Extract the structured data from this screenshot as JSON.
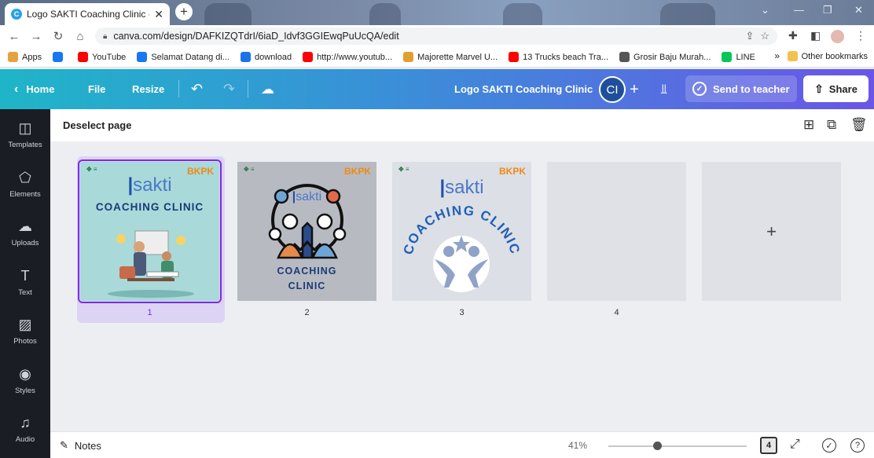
{
  "browser": {
    "tab_title": "Logo SAKTI Coaching Clinic - Log",
    "new_tab_label": "+",
    "url": "canva.com/design/DAFKIZQTdrI/6iaD_Idvf3GGIEwqPuUcQA/edit",
    "bookmarks": [
      {
        "label": "Apps",
        "color": "#e6a23c"
      },
      {
        "label": "",
        "color": "#1877f2"
      },
      {
        "label": "YouTube",
        "color": "#ff0000"
      },
      {
        "label": "Selamat Datang di...",
        "color": "#1877f2"
      },
      {
        "label": "download",
        "color": "#1a73e8"
      },
      {
        "label": "http://www.youtub...",
        "color": "#ff0000"
      },
      {
        "label": "Majorette Marvel U...",
        "color": "#e0a030"
      },
      {
        "label": "13 Trucks beach Tra...",
        "color": "#ff0000"
      },
      {
        "label": "Grosir Baju Murah...",
        "color": "#555555"
      },
      {
        "label": "LINE",
        "color": "#06c755"
      }
    ],
    "bookmarks_more": "»",
    "other_bookmarks": "Other bookmarks"
  },
  "canva": {
    "home_label": "Home",
    "file_label": "File",
    "resize_label": "Resize",
    "design_title": "Logo SAKTI Coaching Clinic",
    "avatar_initials": "CI",
    "send_to_teacher": "Send to teacher",
    "share_label": "Share",
    "brand_gradient": [
      "#1fb5c8",
      "#3a8fd8",
      "#6a56e6"
    ],
    "accent": "#7d2ae8"
  },
  "sidebar": [
    {
      "label": "Templates",
      "icon": "templates-icon",
      "glyph": "◫"
    },
    {
      "label": "Elements",
      "icon": "elements-icon",
      "glyph": "⬠"
    },
    {
      "label": "Uploads",
      "icon": "uploads-icon",
      "glyph": "☁"
    },
    {
      "label": "Text",
      "icon": "text-icon",
      "glyph": "T"
    },
    {
      "label": "Photos",
      "icon": "photos-icon",
      "glyph": "▨"
    },
    {
      "label": "Styles",
      "icon": "styles-icon",
      "glyph": "◉"
    },
    {
      "label": "Audio",
      "icon": "audio-icon",
      "glyph": "♫"
    }
  ],
  "pagebar": {
    "deselect_label": "Deselect page"
  },
  "pages": [
    {
      "number": "1",
      "selected": true,
      "brand": "BKPK",
      "logo_text": "sakti",
      "title_lines": [
        "COACHING CLINIC"
      ]
    },
    {
      "number": "2",
      "selected": false,
      "brand": "BKPK",
      "logo_text": "sakti",
      "title_lines": [
        "COACHING",
        "CLINIC"
      ]
    },
    {
      "number": "3",
      "selected": false,
      "brand": "BKPK",
      "logo_text": "sakti",
      "title_lines": [
        "COACHING CLINIC"
      ]
    },
    {
      "number": "4",
      "selected": false
    },
    {
      "add_label": "+"
    }
  ],
  "bottombar": {
    "notes_label": "Notes",
    "zoom": "41%",
    "zoom_fraction": 0.35,
    "page_count": "4"
  }
}
